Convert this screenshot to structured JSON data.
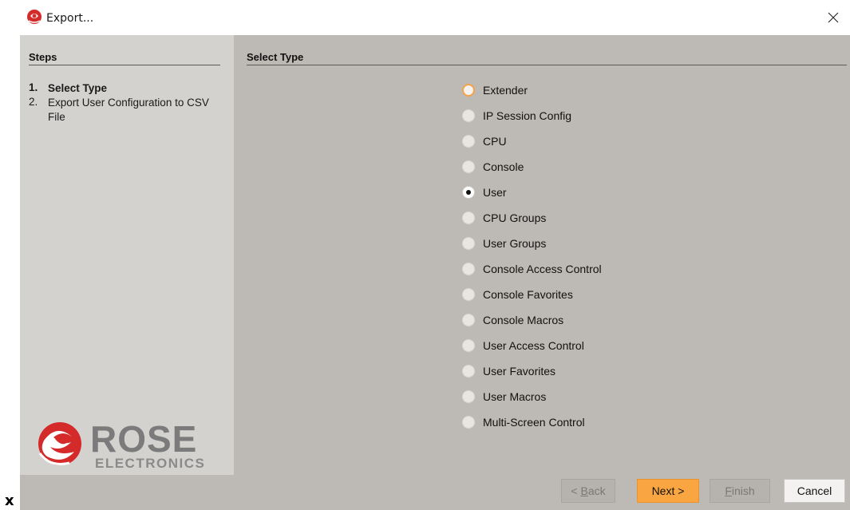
{
  "window": {
    "title": "Export..."
  },
  "steps": {
    "header": "Steps",
    "items": [
      {
        "number": "1.",
        "label": "Select Type",
        "active": true
      },
      {
        "number": "2.",
        "label": "Export User Configuration to CSV File",
        "active": false
      }
    ]
  },
  "main": {
    "header": "Select Type",
    "options": [
      {
        "label": "Extender",
        "state": "focused"
      },
      {
        "label": "IP Session Config",
        "state": "unchecked"
      },
      {
        "label": "CPU",
        "state": "unchecked"
      },
      {
        "label": "Console",
        "state": "unchecked"
      },
      {
        "label": "User",
        "state": "checked"
      },
      {
        "label": "CPU Groups",
        "state": "unchecked"
      },
      {
        "label": "User Groups",
        "state": "unchecked"
      },
      {
        "label": "Console Access Control",
        "state": "unchecked"
      },
      {
        "label": "Console Favorites",
        "state": "unchecked"
      },
      {
        "label": "Console Macros",
        "state": "unchecked"
      },
      {
        "label": "User Access Control",
        "state": "unchecked"
      },
      {
        "label": "User Favorites",
        "state": "unchecked"
      },
      {
        "label": "User Macros",
        "state": "unchecked"
      },
      {
        "label": "Multi-Screen Control",
        "state": "unchecked"
      }
    ]
  },
  "logo": {
    "brand": "ROSE",
    "sub": "ELECTRONICS"
  },
  "buttons": {
    "back": {
      "prefix": "< ",
      "mnemonic": "B",
      "rest": "ack",
      "enabled": false
    },
    "next": {
      "label": "Next >",
      "enabled": true
    },
    "finish": {
      "mnemonic": "F",
      "rest": "inish",
      "enabled": false
    },
    "cancel": {
      "label": "Cancel",
      "enabled": true
    }
  },
  "corner_text": "x",
  "colors": {
    "accent": "#f9a541",
    "steps_bg": "#d4d2cf",
    "main_bg": "#bdb9b4",
    "brand_red": "#d42a2a"
  },
  "icons": [
    "rose-app-icon",
    "close-icon",
    "rose-logo-icon"
  ]
}
